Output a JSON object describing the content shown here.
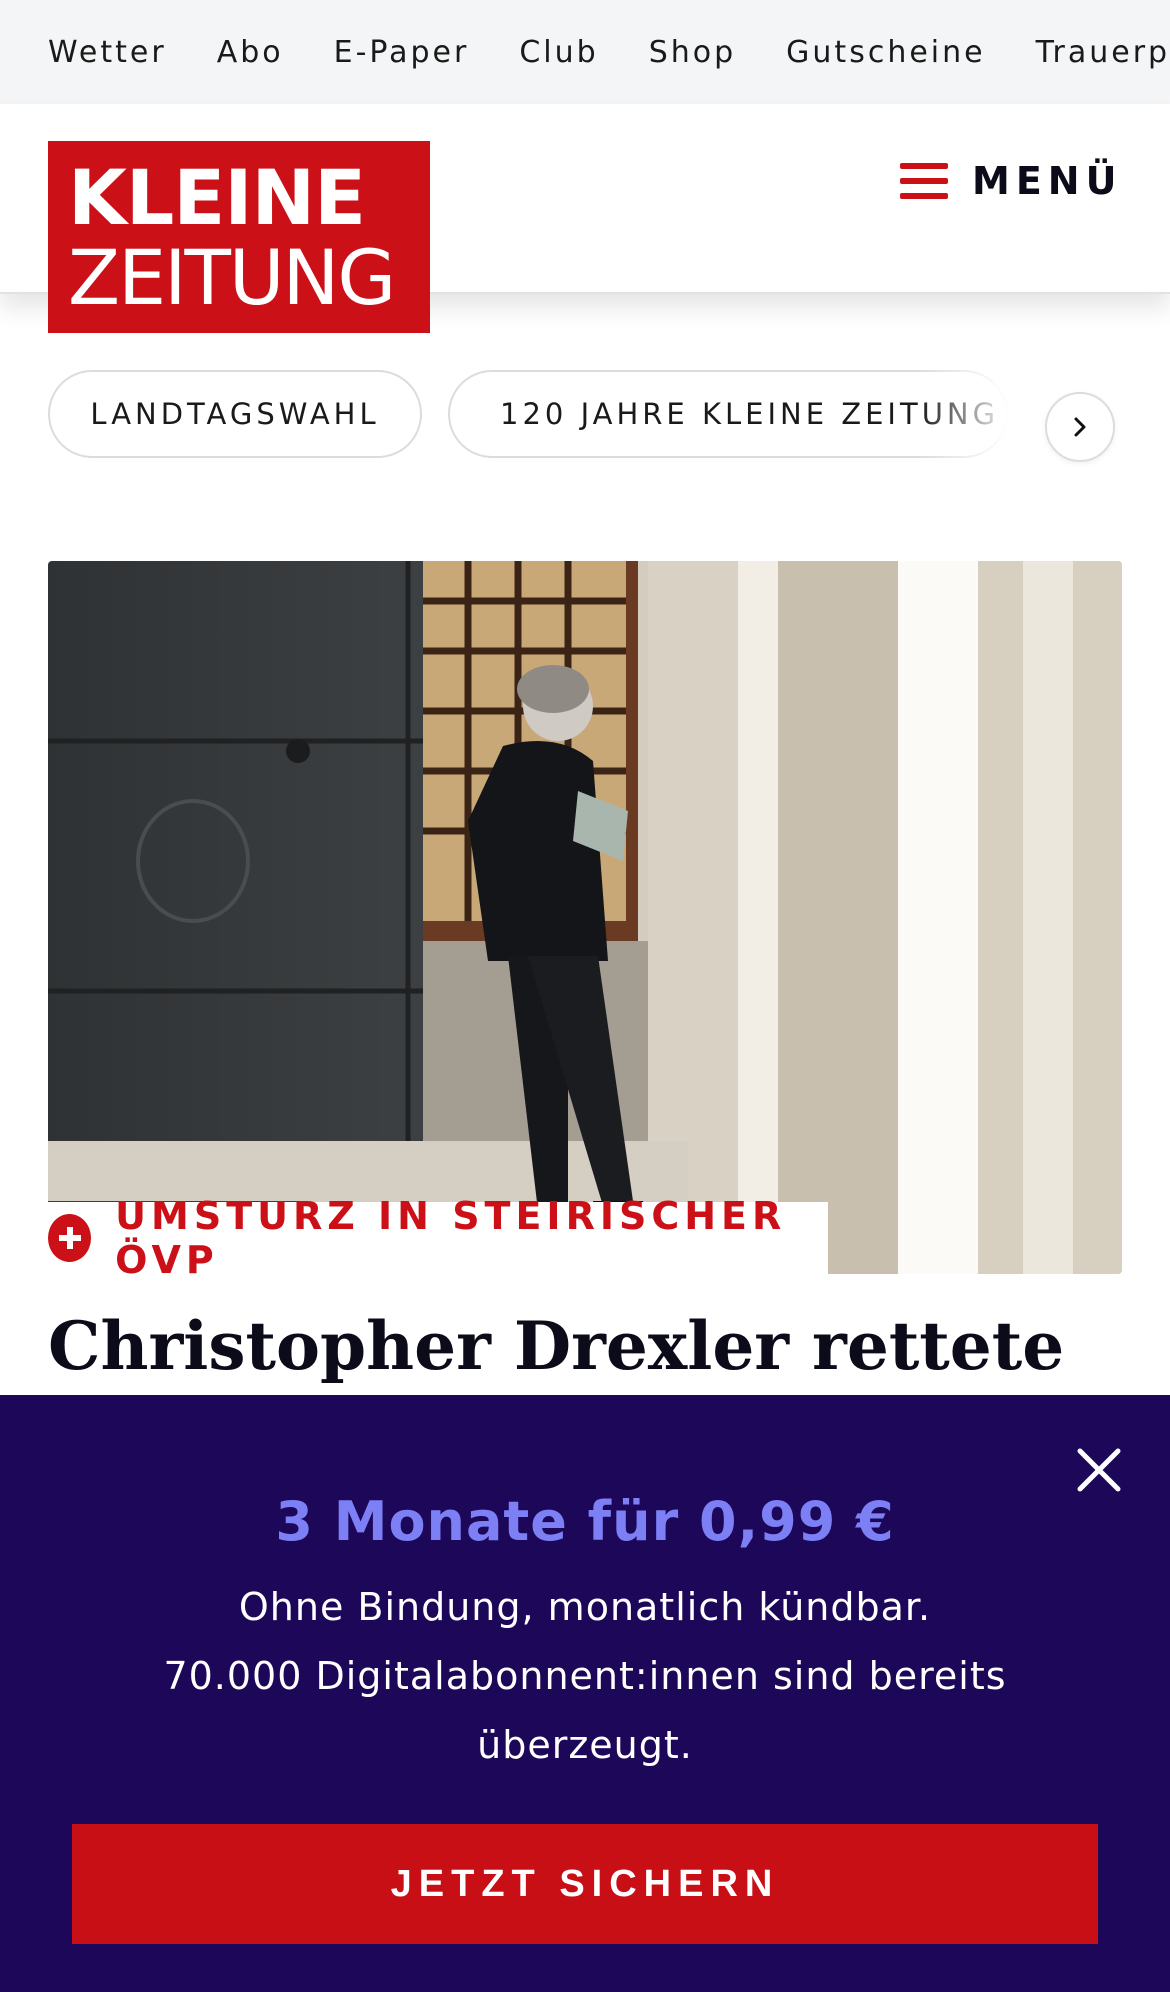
{
  "topnav": {
    "items": [
      "Wetter",
      "Abo",
      "E-Paper",
      "Club",
      "Shop",
      "Gutscheine",
      "Trauerportal"
    ]
  },
  "header": {
    "logo_line1": "KLEINE",
    "logo_line2": "ZEITUNG",
    "menu_label": "MENÜ"
  },
  "topics": {
    "chips": [
      "LANDTAGSWAHL",
      "120 JAHRE KLEINE ZEITUNG"
    ]
  },
  "article": {
    "kicker": "UMSTURZ IN STEIRISCHER ÖVP",
    "headline": "Christopher Drexler rettete"
  },
  "offer": {
    "title": "3 Monate für 0,99 €",
    "line1": "Ohne Bindung, monatlich kündbar.",
    "line2": "70.000 Digitalabonnent:innen sind bereits überzeugt.",
    "cta_label": "JETZT SICHERN"
  },
  "colors": {
    "brand_red": "#cc1017",
    "overlay_bg": "#1c0758",
    "offer_accent": "#7d7ff5"
  }
}
